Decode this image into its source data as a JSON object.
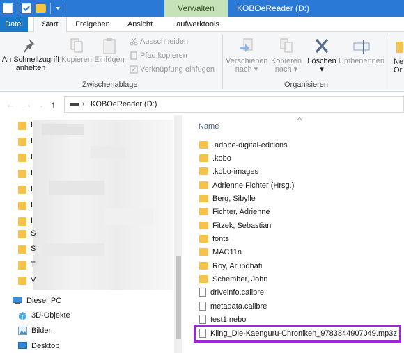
{
  "title_bar": {
    "context_tab": "Verwalten",
    "window_title": "KOBOeReader (D:)"
  },
  "tabs": [
    "Datei",
    "Start",
    "Freigeben",
    "Ansicht",
    "Laufwerktools"
  ],
  "ribbon": {
    "pin_label_1": "An Schnellzugriff",
    "pin_label_2": "anheften",
    "copy": "Kopieren",
    "paste": "Einfügen",
    "cut": "Ausschneiden",
    "copy_path": "Pfad kopieren",
    "paste_shortcut": "Verknüpfung einfügen",
    "group_clipboard": "Zwischenablage",
    "move_to_1": "Verschieben",
    "move_to_2": "nach",
    "copy_to_1": "Kopieren",
    "copy_to_2": "nach",
    "delete": "Löschen",
    "rename": "Umbenennen",
    "group_organize": "Organisieren",
    "new_1": "Ne",
    "new_2": "Or"
  },
  "address": {
    "path": "KOBOeReader (D:)"
  },
  "nav_pane": {
    "letters": [
      "I",
      "I",
      "I",
      "I",
      "I",
      "I",
      "I",
      "S",
      "S",
      "T",
      "V"
    ],
    "this_pc": "Dieser PC",
    "objects_3d": "3D-Objekte",
    "pictures": "Bilder",
    "desktop": "Desktop"
  },
  "file_list": {
    "column_name": "Name",
    "items": [
      {
        "name": ".adobe-digital-editions",
        "type": "folder"
      },
      {
        "name": ".kobo",
        "type": "folder"
      },
      {
        "name": ".kobo-images",
        "type": "folder"
      },
      {
        "name": "Adrienne Fichter (Hrsg.)",
        "type": "folder"
      },
      {
        "name": "Berg, Sibylle",
        "type": "folder"
      },
      {
        "name": "Fichter, Adrienne",
        "type": "folder"
      },
      {
        "name": "Fitzek, Sebastian",
        "type": "folder"
      },
      {
        "name": "fonts",
        "type": "folder"
      },
      {
        "name": "MAC11n",
        "type": "folder"
      },
      {
        "name": "Roy, Arundhati",
        "type": "folder"
      },
      {
        "name": "Schember, John",
        "type": "folder"
      },
      {
        "name": "driveinfo.calibre",
        "type": "file"
      },
      {
        "name": "metadata.calibre",
        "type": "file"
      },
      {
        "name": "test1.nebo",
        "type": "file"
      },
      {
        "name": "Kling_Die-Kaenguru-Chroniken_9783844907049.mp3z",
        "type": "file"
      }
    ]
  },
  "colors": {
    "titlebar": "#2b79d7",
    "context_tab": "#c6e2b8",
    "highlight": "#9b27d6",
    "folder": "#f4c34c"
  }
}
